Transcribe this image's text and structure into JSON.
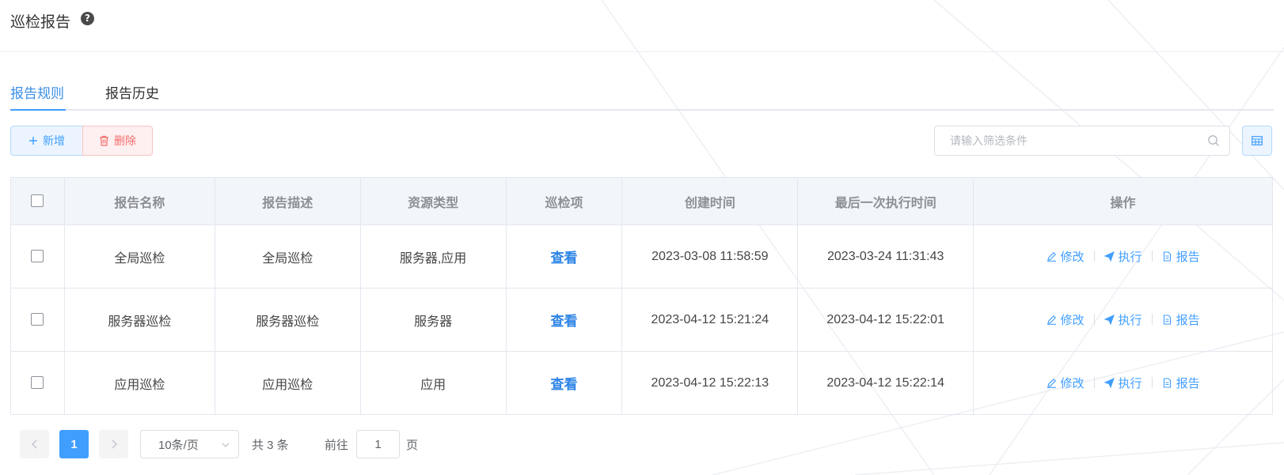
{
  "page": {
    "title": "巡检报告"
  },
  "tabs": [
    {
      "label": "报告规则"
    },
    {
      "label": "报告历史"
    }
  ],
  "toolbar": {
    "add_label": "新增",
    "delete_label": "删除",
    "search_placeholder": "请输入筛选条件"
  },
  "table": {
    "columns": [
      "报告名称",
      "报告描述",
      "资源类型",
      "巡检项",
      "创建时间",
      "最后一次执行时间",
      "操作"
    ],
    "rows": [
      {
        "name": "全局巡检",
        "desc": "全局巡检",
        "type": "服务器,应用",
        "items": "查看",
        "created": "2023-03-08 11:58:59",
        "last_run": "2023-03-24 11:31:43"
      },
      {
        "name": "服务器巡检",
        "desc": "服务器巡检",
        "type": "服务器",
        "items": "查看",
        "created": "2023-04-12 15:21:24",
        "last_run": "2023-04-12 15:22:01"
      },
      {
        "name": "应用巡检",
        "desc": "应用巡检",
        "type": "应用",
        "items": "查看",
        "created": "2023-04-12 15:22:13",
        "last_run": "2023-04-12 15:22:14"
      }
    ],
    "actions": {
      "edit": "修改",
      "run": "执行",
      "report": "报告"
    }
  },
  "pagination": {
    "current_page": "1",
    "page_size": "10条/页",
    "total": "共 3 条",
    "goto_label": "前往",
    "goto_value": "1",
    "page_unit": "页"
  },
  "colors": {
    "primary": "#409eff",
    "danger": "#f56c6c",
    "header_bg": "#f2f5fa"
  }
}
